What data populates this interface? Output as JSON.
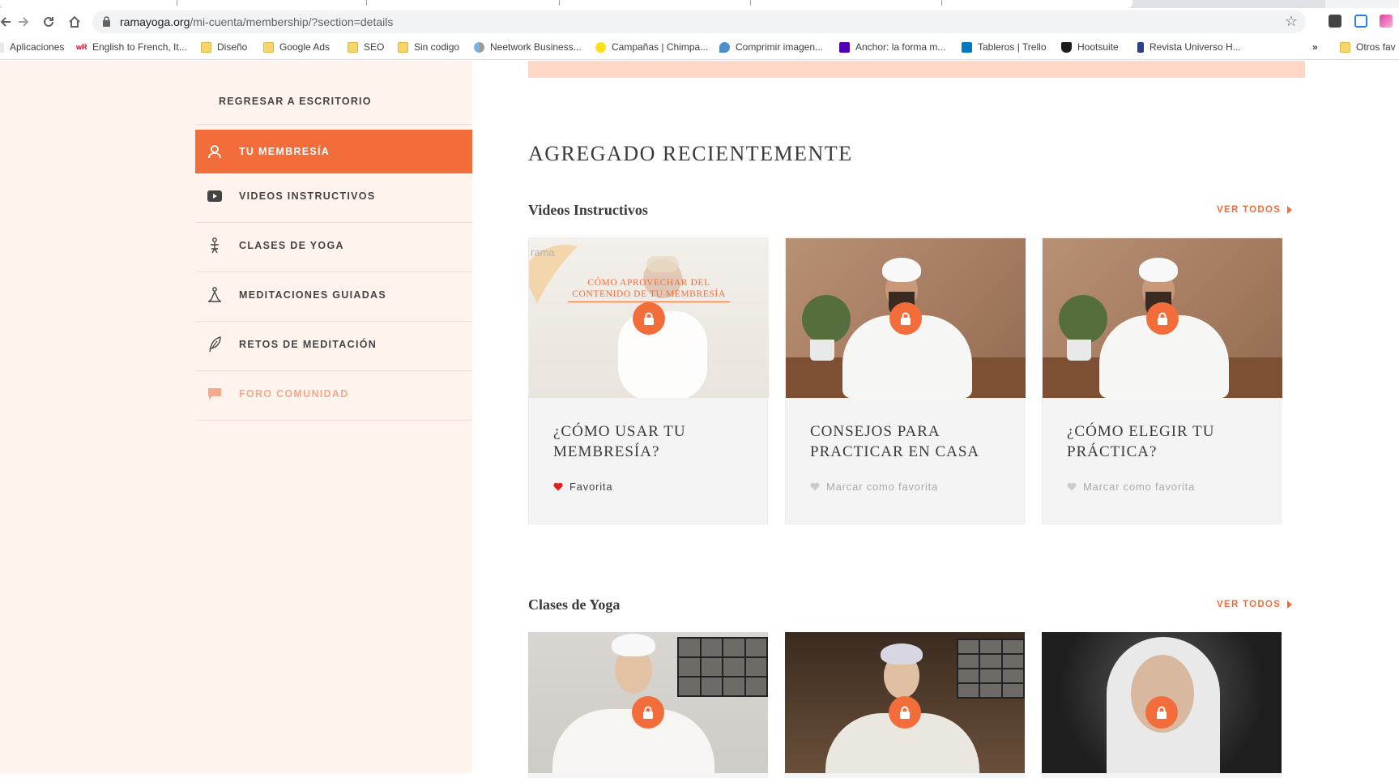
{
  "browser": {
    "url_host": "ramayoga.org",
    "url_path": "/mi-cuenta/membership/?section=details",
    "bookmarks": [
      {
        "label": "Aplicaciones",
        "icon": "apps-grid-icon"
      },
      {
        "label": "English to French, It...",
        "icon": "wordreference-icon"
      },
      {
        "label": "Diseño",
        "icon": "folder-icon"
      },
      {
        "label": "Google Ads",
        "icon": "folder-icon"
      },
      {
        "label": "SEO",
        "icon": "folder-icon"
      },
      {
        "label": "Sin codigo",
        "icon": "folder-icon"
      },
      {
        "label": "Neetwork Business...",
        "icon": "neetwork-icon"
      },
      {
        "label": "Campañas | Chimpa...",
        "icon": "mailchimp-icon"
      },
      {
        "label": "Comprimir imagen...",
        "icon": "compress-icon"
      },
      {
        "label": "Anchor: la forma m...",
        "icon": "anchor-icon"
      },
      {
        "label": "Tableros | Trello",
        "icon": "trello-icon"
      },
      {
        "label": "Hootsuite",
        "icon": "hootsuite-icon"
      },
      {
        "label": "Revista Universo H...",
        "icon": "magazine-icon"
      }
    ],
    "more_bookmarks": "»",
    "other_bookmarks": "Otros fav"
  },
  "sidebar": {
    "back_label": "REGRESAR A ESCRITORIO",
    "items": [
      {
        "label": "TU MEMBRESÍA",
        "icon": "user-icon",
        "state": "active"
      },
      {
        "label": "VIDEOS INSTRUCTIVOS",
        "icon": "video-play-icon",
        "state": "normal"
      },
      {
        "label": "CLASES DE YOGA",
        "icon": "yoga-pose-icon",
        "state": "normal"
      },
      {
        "label": "MEDITACIONES GUIADAS",
        "icon": "meditation-icon",
        "state": "normal"
      },
      {
        "label": "RETOS DE MEDITACIÓN",
        "icon": "feather-icon",
        "state": "normal"
      },
      {
        "label": "FORO COMUNIDAD",
        "icon": "chat-bubble-icon",
        "state": "muted"
      }
    ]
  },
  "main": {
    "section_title": "AGREGADO RECIENTEMENTE",
    "groups": [
      {
        "title": "Videos Instructivos",
        "see_all": "VER TODOS",
        "cards": [
          {
            "title": "¿CÓMO USAR TU MEMBRESÍA?",
            "favorite_label": "Favorita",
            "favorite": true,
            "thumb_logo": "rama",
            "thumb_caption": "CÓMO APROVECHAR DEL CONTENIDO DE TU MEMBRESÍA",
            "locked": true
          },
          {
            "title": "CONSEJOS PARA PRACTICAR EN CASA",
            "favorite_label": "Marcar como favorita",
            "favorite": false,
            "locked": true
          },
          {
            "title": "¿CÓMO ELEGIR TU PRÁCTICA?",
            "favorite_label": "Marcar como favorita",
            "favorite": false,
            "locked": true
          }
        ]
      },
      {
        "title": "Clases de Yoga",
        "see_all": "VER TODOS",
        "cards": [
          {
            "locked": true
          },
          {
            "locked": true
          },
          {
            "locked": true
          }
        ]
      }
    ]
  },
  "colors": {
    "accent": "#f36d3a",
    "sidebar_bg": "#fff3ee",
    "banner": "#ffd7c6",
    "favorite_heart": "#e02020"
  }
}
